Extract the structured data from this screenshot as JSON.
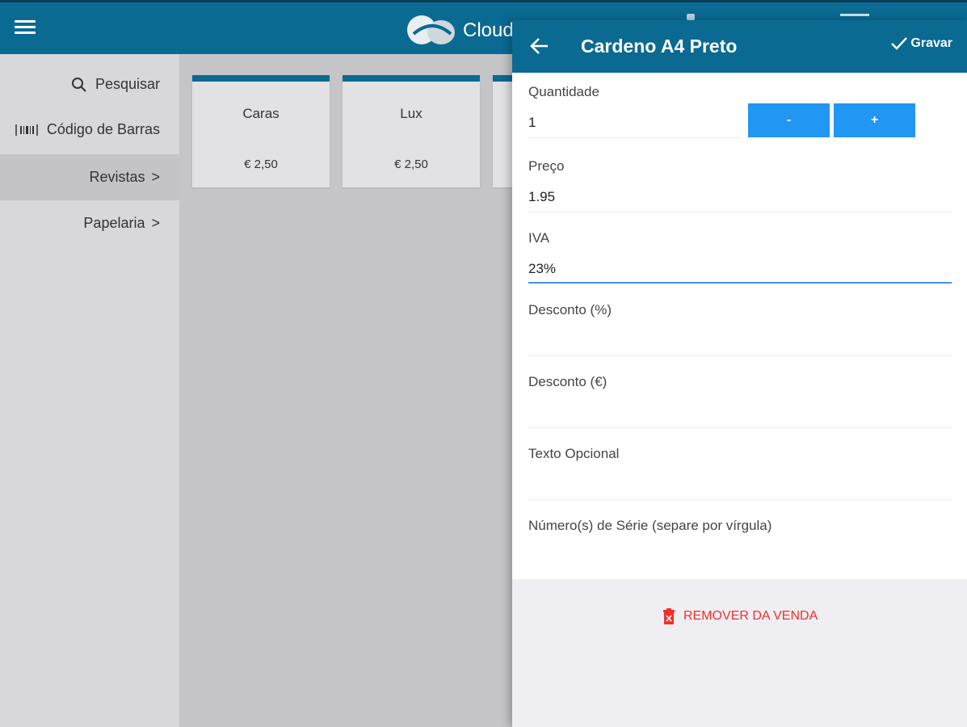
{
  "topbar": {
    "app_name": "Cloud",
    "menu_icon": "hamburger-menu-icon",
    "logo_icon": "cloud-logo-icon"
  },
  "sidebar": {
    "items": [
      {
        "label": "Pesquisar",
        "icon": "search-icon"
      },
      {
        "label": "Código de Barras",
        "icon": "barcode-icon"
      },
      {
        "label": "Revistas",
        "chevron": ">",
        "active": true
      },
      {
        "label": "Papelaria",
        "chevron": ">"
      }
    ]
  },
  "products": [
    {
      "name": "Caras",
      "price": "€ 2,50"
    },
    {
      "name": "Lux",
      "price": "€ 2,50"
    }
  ],
  "panel": {
    "title": "Cardeno A4 Preto",
    "save_label": "Gravar",
    "fields": {
      "quantity": {
        "label": "Quantidade",
        "value": "1"
      },
      "price": {
        "label": "Preço",
        "value": "1.95"
      },
      "vat": {
        "label": "IVA",
        "value": "23%"
      },
      "discount_pct": {
        "label": "Desconto (%)",
        "value": ""
      },
      "discount_eur": {
        "label": "Desconto (€)",
        "value": ""
      },
      "optional_text": {
        "label": "Texto Opcional",
        "value": ""
      },
      "serial_numbers": {
        "label": "Número(s) de Série (separe por vírgula)",
        "value": ""
      }
    },
    "minus_label": "-",
    "plus_label": "+",
    "remove_label": "REMOVER DA VENDA"
  },
  "colors": {
    "header": "#0a6a92",
    "button": "#2196f3",
    "danger": "#f0302b"
  }
}
